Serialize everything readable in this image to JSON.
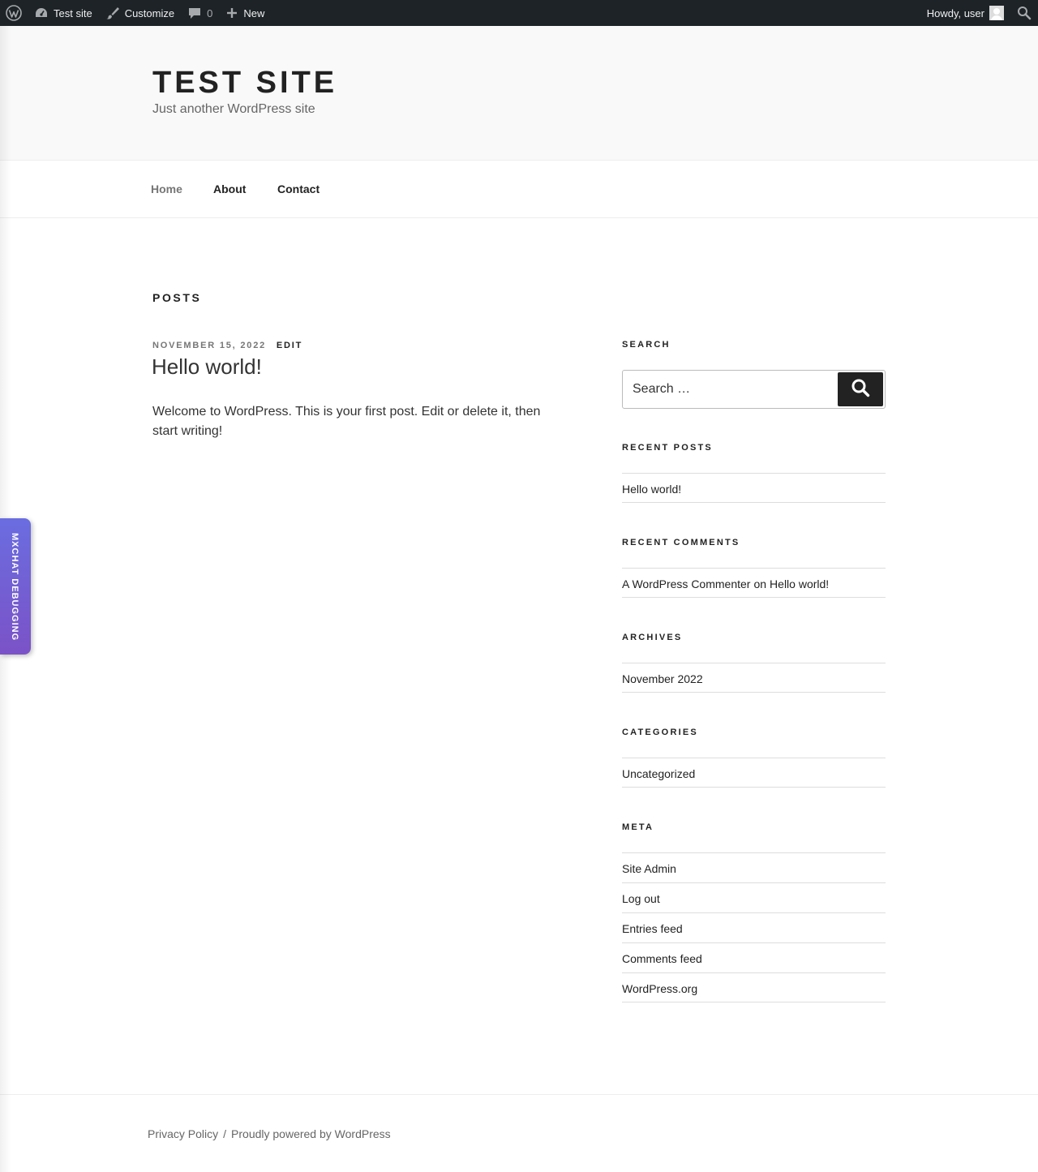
{
  "admin_bar": {
    "site_name": "Test site",
    "customize": "Customize",
    "comments_count": "0",
    "new": "New",
    "howdy": "Howdy, user"
  },
  "header": {
    "title": "TEST SITE",
    "description": "Just another WordPress site"
  },
  "nav": {
    "items": [
      "Home",
      "About",
      "Contact"
    ]
  },
  "main": {
    "section_title": "POSTS",
    "post": {
      "date": "November 15, 2022",
      "edit": "Edit",
      "title": "Hello world!",
      "body": "Welcome to WordPress. This is your first post. Edit or delete it, then start writing!"
    }
  },
  "sidebar": {
    "search": {
      "title": "Search",
      "placeholder": "Search …"
    },
    "recent_posts": {
      "title": "Recent Posts",
      "items": [
        "Hello world!"
      ]
    },
    "recent_comments": {
      "title": "Recent Comments",
      "author": "A WordPress Commenter",
      "on": "on",
      "post": "Hello world!"
    },
    "archives": {
      "title": "Archives",
      "items": [
        "November 2022"
      ]
    },
    "categories": {
      "title": "Categories",
      "items": [
        "Uncategorized"
      ]
    },
    "meta": {
      "title": "Meta",
      "items": [
        "Site Admin",
        "Log out",
        "Entries feed",
        "Comments feed",
        "WordPress.org"
      ]
    }
  },
  "footer": {
    "privacy": "Privacy Policy",
    "separator": "/",
    "powered": "Proudly powered by WordPress"
  },
  "mxchat": {
    "label": "MXCHAT DEBUGGING"
  },
  "colors": {
    "admin_bar_bg": "#1d2327",
    "search_button_bg": "#222222",
    "mxchat_gradient_top": "#6a6de0",
    "mxchat_gradient_bottom": "#7b52c7"
  }
}
